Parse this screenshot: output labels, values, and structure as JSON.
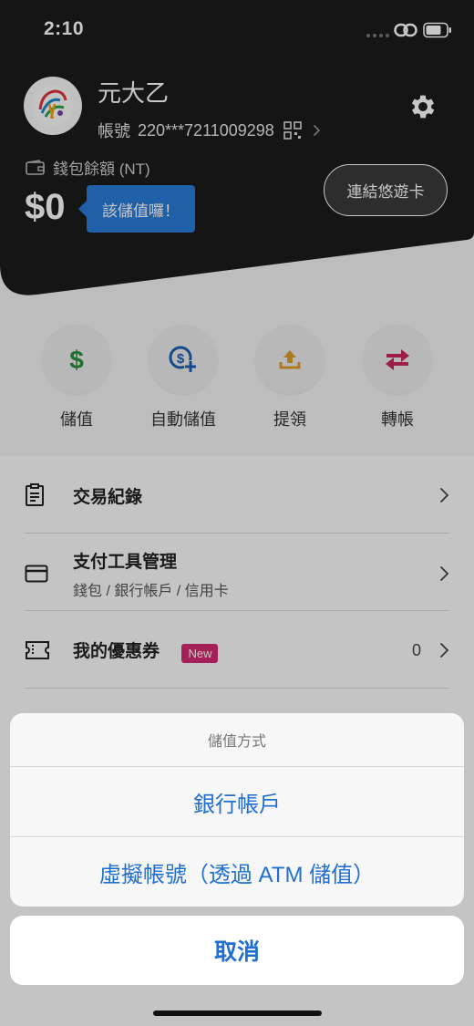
{
  "status_bar": {
    "time": "2:10"
  },
  "header": {
    "user_name": "元大乙",
    "account_label": "帳號",
    "account_number": "220***7211009298",
    "wallet_label": "錢包餘額 (NT)",
    "balance": "$0",
    "tooltip": "該儲值囉！",
    "link_card_button": "連結悠遊卡"
  },
  "actions": [
    {
      "label": "儲值",
      "icon": "dollar-icon",
      "color": "#2e8b3d"
    },
    {
      "label": "自動儲值",
      "icon": "auto-topup-icon",
      "color": "#1f5fb3"
    },
    {
      "label": "提領",
      "icon": "withdraw-icon",
      "color": "#e09b2d"
    },
    {
      "label": "轉帳",
      "icon": "transfer-icon",
      "color": "#c8245f"
    }
  ],
  "menu": [
    {
      "title": "交易紀錄",
      "icon": "clipboard-icon"
    },
    {
      "title": "支付工具管理",
      "subtitle": "錢包 / 銀行帳戶 / 信用卡",
      "icon": "card-icon"
    },
    {
      "title": "我的優惠券",
      "badge": "New",
      "count": "0",
      "icon": "coupon-icon"
    }
  ],
  "action_sheet": {
    "title": "儲值方式",
    "options": [
      "銀行帳戶",
      "虛擬帳號（透過 ATM 儲值）"
    ],
    "cancel": "取消"
  },
  "colors": {
    "header_dark": "#1c1c1c",
    "accent_blue": "#1f6fd3",
    "tooltip_blue": "#2a7bd8",
    "badge_pink": "#d42a6f"
  }
}
